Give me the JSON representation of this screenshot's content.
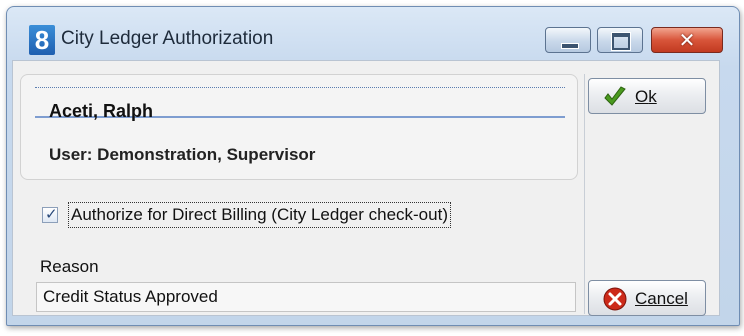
{
  "window": {
    "title": "City Ledger Authorization",
    "app_icon_glyph": "8",
    "controls": {
      "minimize_icon": "minimize-icon",
      "maximize_icon": "maximize-icon",
      "close_icon": "close-icon",
      "close_glyph": "✕"
    }
  },
  "info": {
    "guest_name": "Aceti, Ralph",
    "user": "User: Demonstration, Supervisor"
  },
  "authorize": {
    "label": "Authorize for Direct Billing (City Ledger check-out)",
    "checked": true
  },
  "reason": {
    "label": "Reason",
    "value": "Credit Status Approved"
  },
  "buttons": {
    "ok": {
      "mnemonic": "O",
      "rest": "k",
      "icon": "checkmark-icon",
      "color": "#4a9a1f"
    },
    "cancel": {
      "mnemonic": "C",
      "rest": "ancel",
      "icon": "cancel-icon",
      "color": "#cc2a1a"
    }
  }
}
